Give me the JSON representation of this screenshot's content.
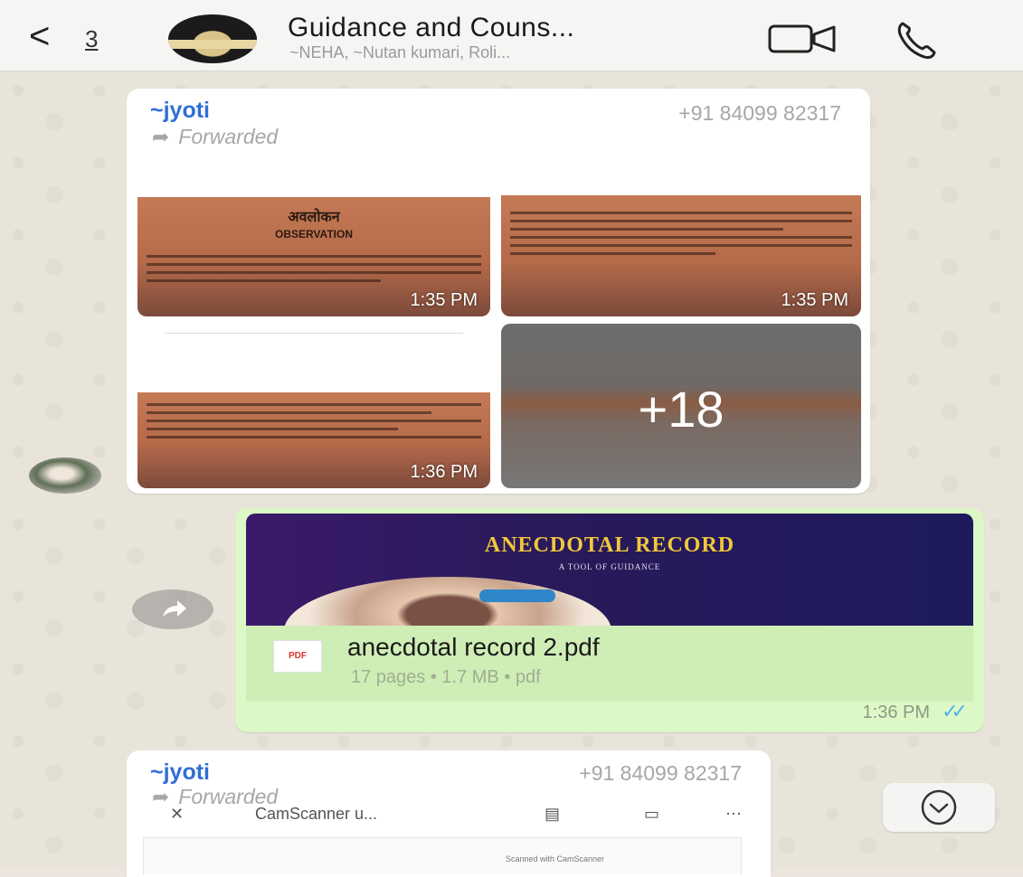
{
  "header": {
    "back_icon": "chevron-left-icon",
    "unread_count": "3",
    "group_title": "Guidance and Couns...",
    "group_members": "~NEHA, ~Nutan kumari, Roli...",
    "video_icon": "video-camera-icon",
    "call_icon": "phone-icon"
  },
  "messages": [
    {
      "direction": "incoming",
      "sender": "~jyoti",
      "phone": "+91 84099 82317",
      "forwarded_label": "Forwarded",
      "album": [
        {
          "time": "1:35 PM",
          "title_hi": "अवलोकन",
          "title_en": "OBSERVATION"
        },
        {
          "time": "1:35 PM"
        },
        {
          "time": "1:36 PM"
        },
        {
          "more_label": "+18"
        }
      ]
    },
    {
      "direction": "outgoing",
      "preview_title": "ANECDOTAL RECORD",
      "preview_subtitle": "A TOOL OF GUIDANCE",
      "file_icon_label": "PDF",
      "file_name": "anecdotal record 2.pdf",
      "file_meta": "17 pages • 1.7 MB • pdf",
      "time": "1:36 PM",
      "status": "read",
      "tick_color": "#4fb6ec"
    },
    {
      "direction": "incoming",
      "sender": "~jyoti",
      "phone": "+91 84099 82317",
      "forwarded_label": "Forwarded",
      "scan_bar": {
        "close": "✕",
        "title": "CamScanner u...",
        "more": "⋯"
      },
      "scan_note": "Scanned with CamScanner"
    }
  ],
  "scroll_down_icon": "chevron-down-circle-icon",
  "colors": {
    "incoming_bubble": "#ffffff",
    "outgoing_bubble": "#dcf8c6",
    "sender_name": "#2f6fd6",
    "preview_title": "#f2c83a"
  }
}
